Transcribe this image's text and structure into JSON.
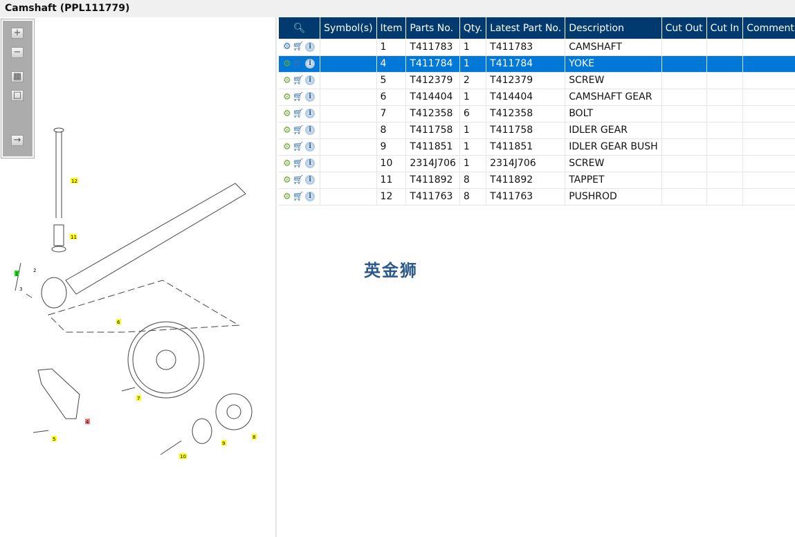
{
  "title": "Camshaft (PPL111779)",
  "toolbar": {
    "zoom_in": "zoom-in",
    "zoom_out": "zoom-out",
    "fit": "fit",
    "actual": "actual-size",
    "export": "export"
  },
  "diagram": {
    "callouts": [
      "12",
      "11",
      "1",
      "2",
      "3",
      "6",
      "7",
      "4",
      "5",
      "9",
      "8",
      "10"
    ]
  },
  "table": {
    "headers": [
      "Symbol(s)",
      "Item",
      "Parts No.",
      "Qty.",
      "Latest Part No.",
      "Description",
      "Cut Out",
      "Cut In",
      "Comment"
    ],
    "selected_row": 1,
    "rows": [
      {
        "item": "1",
        "part": "T411783",
        "qty": "1",
        "latest": "T411783",
        "desc": "CAMSHAFT"
      },
      {
        "item": "4",
        "part": "T411784",
        "qty": "1",
        "latest": "T411784",
        "desc": "YOKE"
      },
      {
        "item": "5",
        "part": "T412379",
        "qty": "2",
        "latest": "T412379",
        "desc": "SCREW"
      },
      {
        "item": "6",
        "part": "T414404",
        "qty": "1",
        "latest": "T414404",
        "desc": "CAMSHAFT GEAR"
      },
      {
        "item": "7",
        "part": "T412358",
        "qty": "6",
        "latest": "T412358",
        "desc": "BOLT"
      },
      {
        "item": "8",
        "part": "T411758",
        "qty": "1",
        "latest": "T411758",
        "desc": "IDLER GEAR"
      },
      {
        "item": "9",
        "part": "T411851",
        "qty": "1",
        "latest": "T411851",
        "desc": "IDLER GEAR BUSH"
      },
      {
        "item": "10",
        "part": "2314J706",
        "qty": "1",
        "latest": "2314J706",
        "desc": "SCREW"
      },
      {
        "item": "11",
        "part": "T411892",
        "qty": "8",
        "latest": "T411892",
        "desc": "TAPPET"
      },
      {
        "item": "12",
        "part": "T411763",
        "qty": "8",
        "latest": "T411763",
        "desc": "PUSHROD"
      }
    ]
  },
  "watermark": "英金狮",
  "colors": {
    "header": "#003a6f",
    "selected": "#0078d7",
    "callout": "#ffff00",
    "callout_selected": "#f08080",
    "callout_green": "#00e000"
  }
}
